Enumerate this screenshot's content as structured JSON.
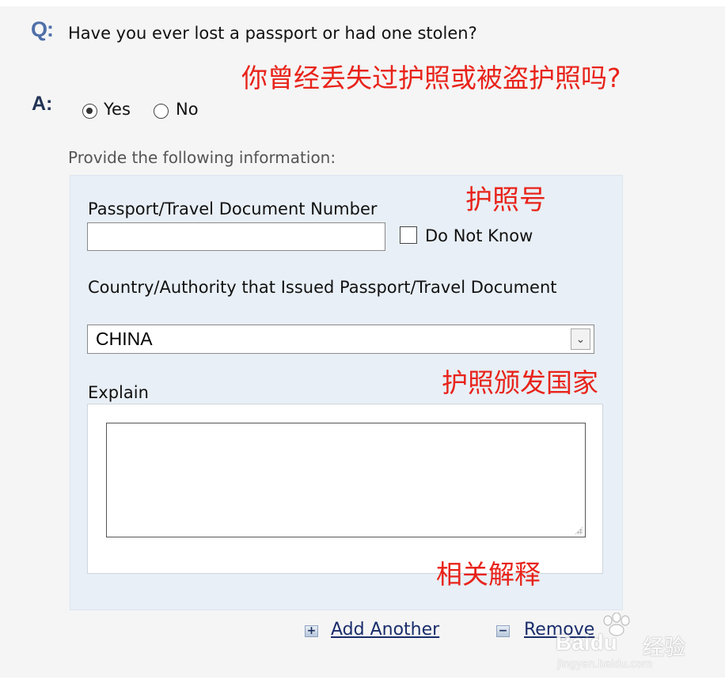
{
  "question": {
    "label": "Q:",
    "text": "Have you ever lost a passport or had one stolen?",
    "annotation": "你曾经丢失过护照或被盗护照吗?"
  },
  "answer": {
    "label": "A:",
    "options": [
      "Yes",
      "No"
    ],
    "selected": "Yes"
  },
  "provide_text": "Provide the following information:",
  "passport_number": {
    "label": "Passport/Travel Document Number",
    "value": "",
    "do_not_know_label": "Do Not Know",
    "do_not_know_checked": false,
    "annotation": "护照号"
  },
  "country": {
    "label": "Country/Authority that Issued Passport/Travel Document",
    "selected": "CHINA",
    "annotation": "护照颁发国家"
  },
  "explain": {
    "label": "Explain",
    "value": "",
    "annotation": "相关解释"
  },
  "actions": {
    "add_label": "Add Another",
    "add_icon": "+",
    "remove_label": "Remove",
    "remove_icon": "−"
  },
  "watermark": {
    "logo": "Baidu",
    "text": "经验",
    "url": "jingyan.baidu.com"
  },
  "colors": {
    "annotation_red": "#e8231a",
    "q_blue": "#4f6fa8",
    "link_blue": "#1a2d6b",
    "box_bg": "#e8eff6"
  }
}
